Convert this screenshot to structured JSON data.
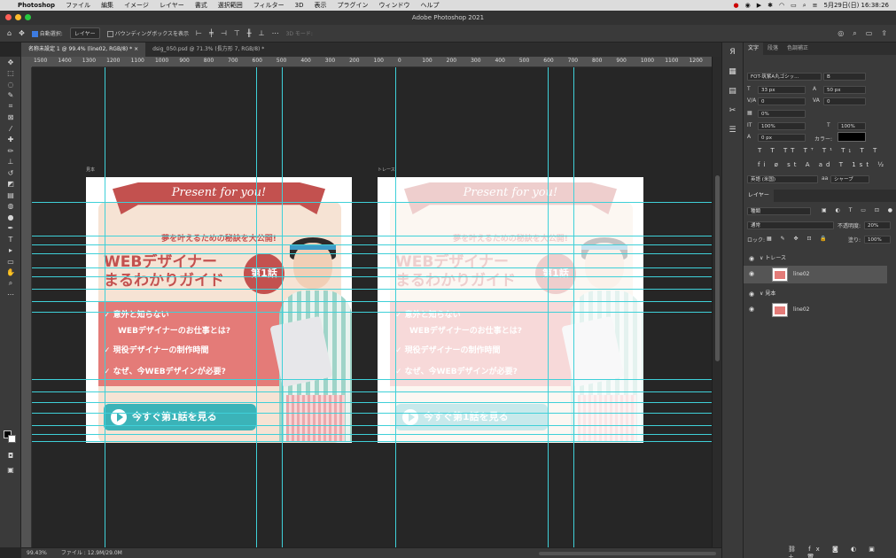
{
  "menubar": {
    "app": "Photoshop",
    "items": [
      "ファイル",
      "編集",
      "イメージ",
      "レイヤー",
      "書式",
      "選択範囲",
      "フィルター",
      "3D",
      "表示",
      "プラグイン",
      "ウィンドウ",
      "ヘルプ"
    ],
    "datetime": "5月29日(日)  16:38:26"
  },
  "titlebar": {
    "title": "Adobe Photoshop 2021"
  },
  "options": {
    "auto_select_label": "自動選択:",
    "auto_select_value": "レイヤー",
    "bounding_box_label": "バウンディングボックスを表示",
    "mode3d_label": "3D モード:"
  },
  "tabs": [
    {
      "label": "名称未設定 1 @ 99.4% (line02, RGB/8) *"
    },
    {
      "label": "dsig_050.psd @ 71.3% (長方形 7, RGB/8) *"
    }
  ],
  "ruler_ticks": [
    "1500",
    "1400",
    "1300",
    "1200",
    "1100",
    "1000",
    "900",
    "800",
    "700",
    "600",
    "500",
    "400",
    "300",
    "200",
    "100",
    "0",
    "100",
    "200",
    "300",
    "400",
    "500",
    "600",
    "700",
    "800",
    "900",
    "1000",
    "1100",
    "1200"
  ],
  "artboards": {
    "left_label": "見本",
    "right_label": "トレース"
  },
  "banner": {
    "ribbon": "Present for you!",
    "tagline": "夢を叶えるための秘訣を大公開!",
    "title_line1": "WEBデザイナー",
    "title_line2": "まるわかりガイド",
    "episode": "第1話",
    "bullets": [
      "✓ 意外と知らない",
      "WEBデザイナーのお仕事とは?",
      "✓ 現役デザイナーの制作時間",
      "✓ なぜ、今WEBデザインが必要?"
    ],
    "cta": "今すぐ第1話を見る"
  },
  "status": {
    "zoom": "99.43%",
    "file": "ファイル : 12.9M/29.0M"
  },
  "char_panel": {
    "tabs": [
      "文字",
      "段落",
      "色調補正"
    ],
    "font": "FOT-筑紫A丸ゴシッ...",
    "style": "B",
    "size": "33 px",
    "leading": "50 px",
    "kerning": "0",
    "tracking": "0",
    "tsume": "0%",
    "vscale": "100%",
    "hscale": "100%",
    "baseline": "0 px",
    "color_label": "カラー:",
    "lang": "英語 (米国)",
    "aa_label": "aa",
    "aa": "シャープ"
  },
  "layers_panel": {
    "title": "レイヤー",
    "filter": "種類",
    "blend": "通常",
    "opacity_label": "不透明度:",
    "opacity": "20%",
    "lock_label": "ロック:",
    "fill_label": "塗り:",
    "fill": "100%",
    "groups": [
      {
        "name": "トレース",
        "layer": "line02"
      },
      {
        "name": "見本",
        "layer": "line02"
      }
    ]
  }
}
